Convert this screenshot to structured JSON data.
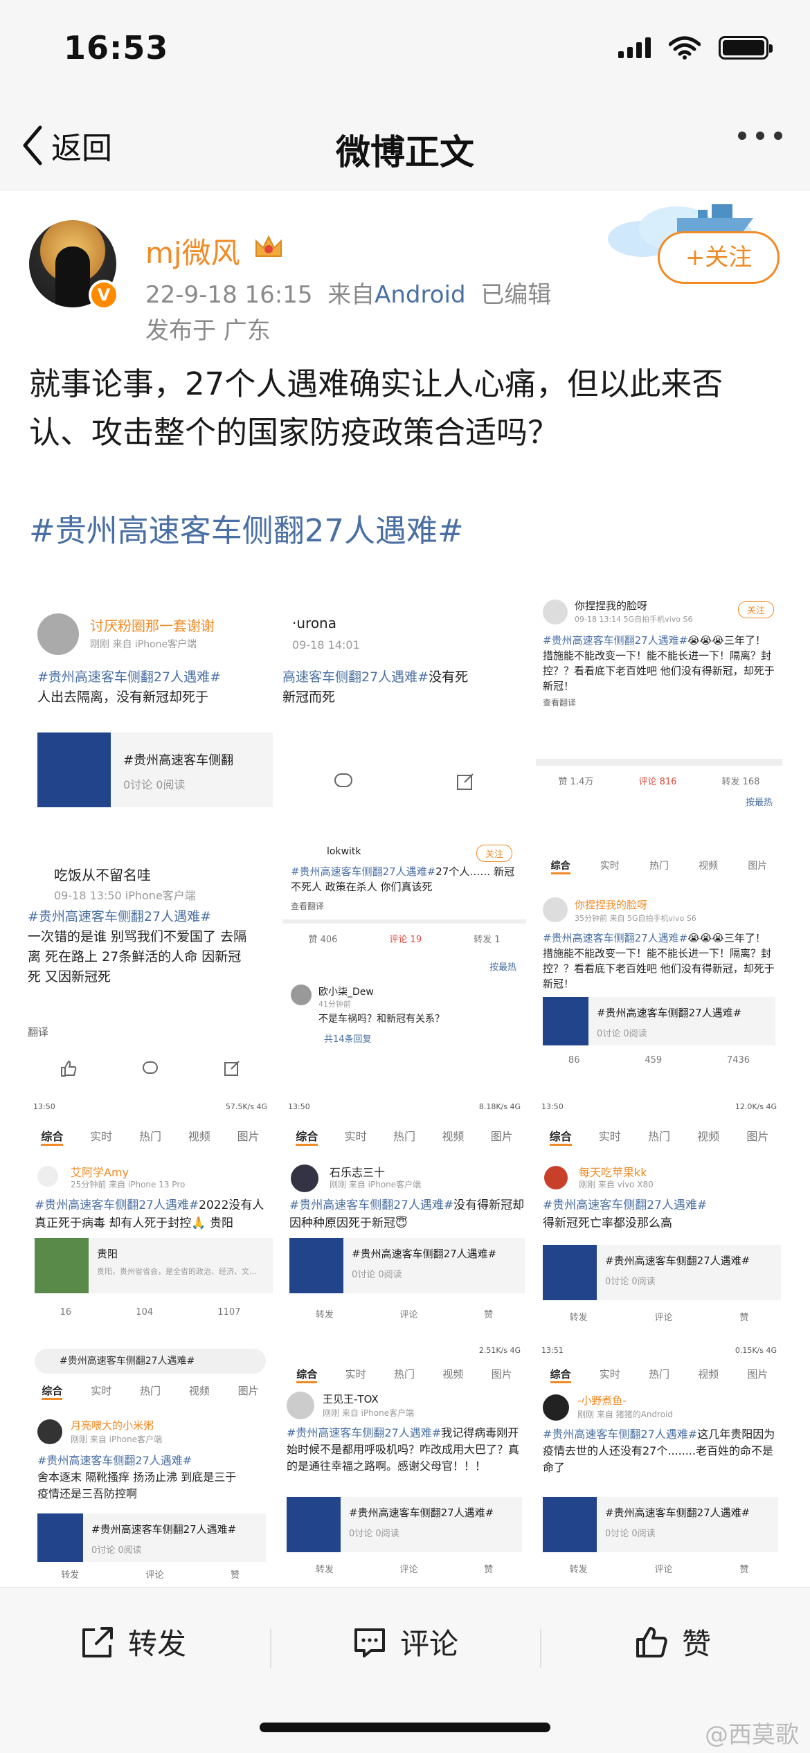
{
  "status_bar": {
    "time": "16:53"
  },
  "nav": {
    "back_label": "返回",
    "title": "微博正文"
  },
  "post": {
    "author": "mj微风",
    "time": "22-9-18 16:15",
    "source_prefix": "来自",
    "source": "Android",
    "edited": "已编辑",
    "location": "发布于 广东",
    "follow_label": "+关注",
    "verified_mark": "V",
    "text": "就事论事，27个人遇难确实让人心痛，但以此来否认、攻击整个的国家防疫政策合适吗？",
    "topic": "#贵州高速客车侧翻27人遇难#"
  },
  "collage": {
    "t1": {
      "name": "讨厌粉圈那一套谢谢",
      "sub": "刚刚 来自 iPhone客户端",
      "text_topic": "#贵州高速客车侧翻27人遇难#",
      "text_rest": "人出去隔离，没有新冠却死于",
      "card_title": "#贵州高速客车侧翻",
      "card_stat": "0讨论 0阅读"
    },
    "t2": {
      "name": "·urona",
      "sub": "09-18 14:01",
      "text_topic": "高速客车侧翻27人遇难#",
      "text_rest": "没有死",
      "line2": "新冠而死"
    },
    "t3": {
      "name": "你捏捏我的脸呀",
      "sub": "09-18 13:14  5G自拍手机vivo S6",
      "follow": "关注",
      "text_topic": "#贵州高速客车侧翻27人遇难#",
      "text_rest": "😭😭😭三年了！措施能不能改变一下！能不能长进一下！隔离？封控？？看看底下老百姓吧 他们没有得新冠，却死于新冠！",
      "translate": "查看翻译",
      "likes": "赞 1.4万",
      "comments": "评论 816",
      "reposts": "转发 168",
      "sort": "按最热"
    },
    "t4": {
      "name": "吃饭从不留名哇",
      "sub": "09-18 13:50  iPhone客户端",
      "text_topic": "#贵州高速客车侧翻27人遇难#",
      "text_rest": "一次错的是谁 别骂我们不爱国了 去隔离 死在路上 27条鲜活的人命 因新冠死 又因新冠死",
      "translate": "翻译"
    },
    "t5": {
      "name": "lokwitk",
      "follow": "关注",
      "text_topic": "#贵州高速客车侧翻27人遇难#",
      "text_rest": "27个人…… 新冠不死人 政策在杀人 你们真该死",
      "translate": "查看翻译",
      "likes": "赞 406",
      "comments": "评论 19",
      "reposts": "转发 1",
      "sort": "按最热",
      "c_name": "欧小柒_Dew",
      "c_sub": "41分钟前",
      "c_text": "不是车祸吗？和新冠有关系？",
      "c_replies": "共14条回复"
    },
    "t6": {
      "name": "你捏捏我的脸呀",
      "sub": "35分钟前 来自 5G自拍手机vivo S6",
      "text_topic": "#贵州高速客车侧翻27人遇难#",
      "text_rest": "😭😭😭三年了！措施能不能改变一下！能不能长进一下！隔离？封控？？看看底下老百姓吧 他们没有得新冠，却死于新冠！",
      "card_title": "#贵州高速客车侧翻27人遇难#",
      "card_stat": "0讨论 0阅读",
      "reposts": "86",
      "comments": "459",
      "likes": "7436"
    },
    "tabs": [
      "综合",
      "实时",
      "热门",
      "视频",
      "图片"
    ],
    "t7": {
      "status_left": "13:50",
      "status_right": "57.5K/s 4G",
      "name": "艾阿学Amy",
      "sub": "25分钟前 来自 iPhone 13 Pro",
      "text_topic": "#贵州高速客车侧翻27人遇难#",
      "text_rest": "2022没有人真正死于病毒 却有人死于封控🙏 贵阳",
      "card_title": "贵阳",
      "card_stat": "贵阳，贵州省省会，是全省的政治、经济、文...",
      "reposts": "16",
      "comments": "104",
      "likes": "1107"
    },
    "t8": {
      "status_left": "13:50",
      "status_right": "8.18K/s 4G",
      "name": "石乐志三十",
      "sub": "刚刚 来自 iPhone客户端",
      "text_topic": "#贵州高速客车侧翻27人遇难#",
      "text_rest": "没有得新冠却因种种原因死于新冠😇",
      "card_title": "#贵州高速客车侧翻27人遇难#",
      "card_stat": "0讨论 0阅读",
      "reposts": "转发",
      "comments": "评论",
      "likes": "赞"
    },
    "t9": {
      "status_left": "13:50",
      "status_right": "12.0K/s 4G",
      "name": "每天吃苹果kk",
      "sub": "刚刚 来自 vivo X80",
      "text_topic": "#贵州高速客车侧翻27人遇难#",
      "text_rest": "得新冠死亡率都没那么高",
      "card_title": "#贵州高速客车侧翻27人遇难#",
      "card_stat": "0讨论 0阅读",
      "reposts": "转发",
      "comments": "评论",
      "likes": "赞"
    },
    "t10": {
      "search": "#贵州高速客车侧翻27人遇难#",
      "name": "月亮喂大的小米粥",
      "sub": "刚刚 来自 iPhone客户端",
      "text_topic": "#贵州高速客车侧翻27人遇难#",
      "text_rest": "舍本逐末 隔靴搔痒 扬汤止沸 到底是三于疫情还是三吾防控啊",
      "card_title": "#贵州高速客车侧翻27人遇难#",
      "card_stat": "0讨论 0阅读",
      "reposts": "转发",
      "comments": "评论",
      "likes": "赞"
    },
    "t11": {
      "status_right": "2.51K/s 4G",
      "name": "王见王-TOX",
      "sub": "刚刚 来自 iPhone客户端",
      "text_topic": "#贵州高速客车侧翻27人遇难#",
      "text_rest": "我记得病毒刚开始时候不是都用呼吸机吗？咋改成用大巴了？真的是通往幸福之路啊。感谢父母官！！！",
      "card_title": "#贵州高速客车侧翻27人遇难#",
      "card_stat": "0讨论 0阅读",
      "reposts": "转发",
      "comments": "评论",
      "likes": "赞"
    },
    "t12": {
      "status_left": "13:51",
      "status_right": "0.15K/s 4G",
      "name": "-小野煮鱼-",
      "sub": "刚刚 来自 猪猪的Android",
      "text_topic": "#贵州高速客车侧翻27人遇难#",
      "text_rest": "这几年贵阳因为疫情去世的人还没有27个........老百姓的命不是命了",
      "card_title": "#贵州高速客车侧翻27人遇难#",
      "card_stat": "0讨论 0阅读",
      "reposts": "转发",
      "comments": "评论",
      "likes": "赞"
    }
  },
  "bottom": {
    "repost_label": "转发",
    "comment_label": "评论",
    "like_label": "赞"
  },
  "watermark": "@西莫歌",
  "colors": {
    "accent": "#f08a24",
    "link": "#4a6fa3",
    "card_thumb": "#22448a"
  }
}
